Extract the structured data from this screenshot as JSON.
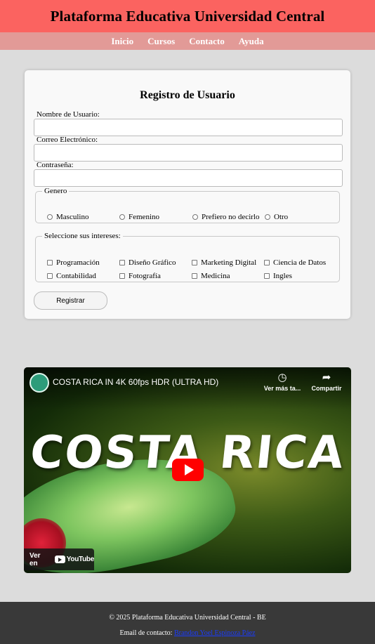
{
  "header": {
    "title": "Plataforma Educativa Universidad Central"
  },
  "nav": {
    "items": [
      "Inicio",
      "Cursos",
      "Contacto",
      "Ayuda"
    ]
  },
  "form": {
    "title": "Registro de Usuario",
    "username_label": "Nombre de Usuario:",
    "email_label": "Correo Electrónico:",
    "password_label": "Contraseña:",
    "gender": {
      "legend": "Genero",
      "options": [
        "Masculino",
        "Femenino",
        "Prefiero no decirlo",
        "Otro"
      ]
    },
    "interests": {
      "legend": "Seleccione sus intereses:",
      "options": [
        "Programación",
        "Diseño Gráfico",
        "Marketing Digital",
        "Ciencia de Datos",
        "Contabilidad",
        "Fotografía",
        "Medicina",
        "Ingles"
      ]
    },
    "submit_label": "Registrar"
  },
  "video": {
    "title": "COSTA RICA IN 4K 60fps HDR (ULTRA HD)",
    "watch_later": "Ver más ta...",
    "share": "Compartir",
    "overlay_text": "COSTA RICA",
    "watch_on": "Ver en",
    "platform": "YouTube",
    "accent": "#ff0000"
  },
  "footer": {
    "copyright": "© 2025 Plataforma Educativa Universidad Central - BE",
    "contact_prefix": "Email de contacto:",
    "contact_name": "Brandon Yoel Espinoza Páez"
  },
  "colors": {
    "header": "#fb6360",
    "nav": "#e29a97",
    "footer": "#393939",
    "background": "#dcdcdc"
  }
}
